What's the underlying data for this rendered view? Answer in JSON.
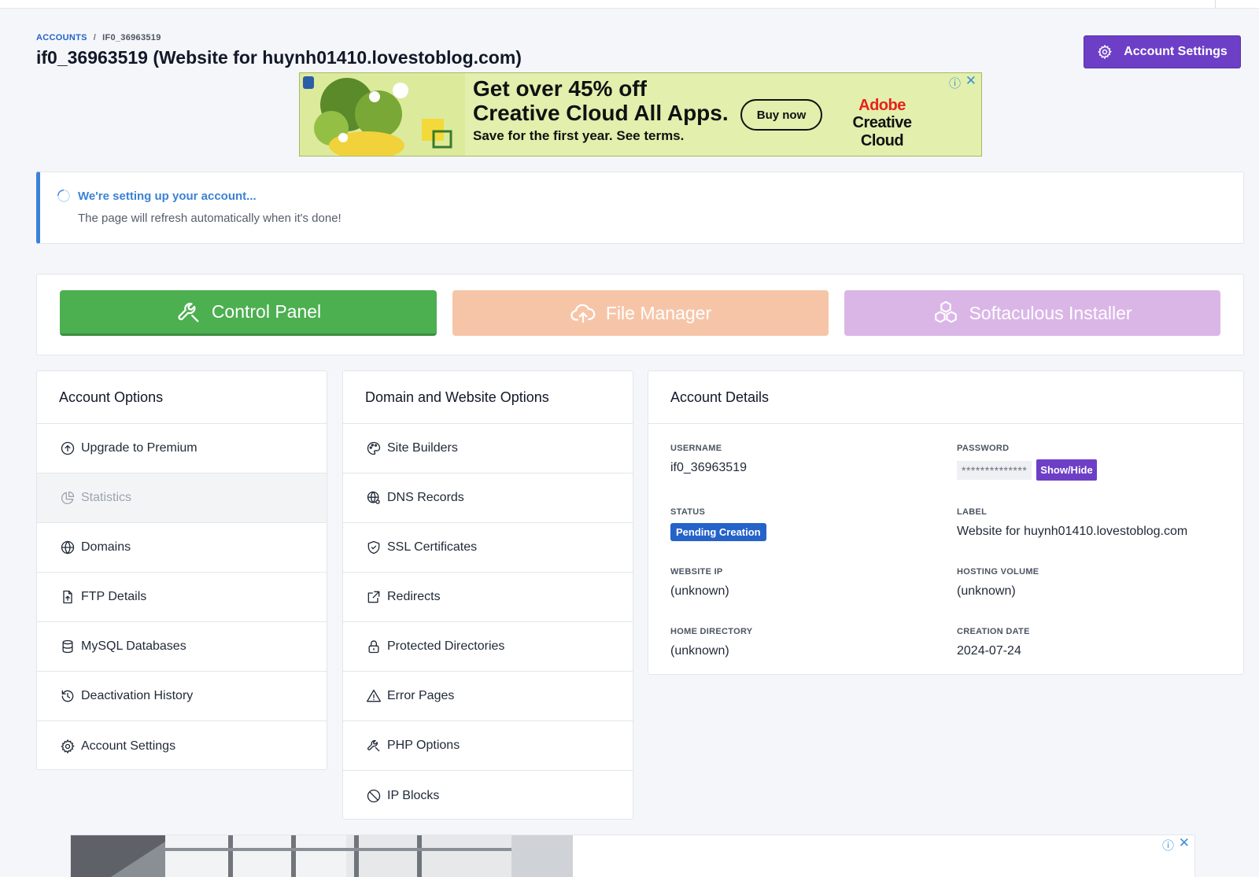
{
  "breadcrumb": {
    "root": "ACCOUNTS",
    "separator": "/",
    "current": "IF0_36963519"
  },
  "page": {
    "title": "if0_36963519 (Website for huynh01410.lovestoblog.com)"
  },
  "header_button": {
    "label": "Account Settings",
    "icon": "gear-icon"
  },
  "ad_top": {
    "headline_line1": "Get over 45% off",
    "headline_line2": "Creative Cloud All Apps.",
    "subtext": "Save for the first year. See terms.",
    "cta": "Buy now",
    "brand_line1": "Adobe",
    "brand_line2": "Creative Cloud",
    "info_icon": "ⓘ",
    "close_icon": "✕"
  },
  "notice": {
    "title": "We're setting up your account...",
    "text": "The page will refresh automatically when it's done!"
  },
  "big_buttons": [
    {
      "label": "Control Panel",
      "icon": "wrench-icon",
      "color": "#4caf50"
    },
    {
      "label": "File Manager",
      "icon": "cloud-upload-icon",
      "color": "#f6c5a8"
    },
    {
      "label": "Softaculous Installer",
      "icon": "boxes-icon",
      "color": "#dab6e7"
    }
  ],
  "account_options": {
    "title": "Account Options",
    "items": [
      {
        "label": "Upgrade to Premium",
        "icon": "arrow-up-circle-icon"
      },
      {
        "label": "Statistics",
        "icon": "pie-chart-icon",
        "disabled": true
      },
      {
        "label": "Domains",
        "icon": "globe-icon"
      },
      {
        "label": "FTP Details",
        "icon": "file-upload-icon"
      },
      {
        "label": "MySQL Databases",
        "icon": "database-icon"
      },
      {
        "label": "Deactivation History",
        "icon": "history-icon"
      },
      {
        "label": "Account Settings",
        "icon": "gear-icon"
      }
    ]
  },
  "domain_options": {
    "title": "Domain and Website Options",
    "items": [
      {
        "label": "Site Builders",
        "icon": "palette-icon"
      },
      {
        "label": "DNS Records",
        "icon": "globe-network-icon"
      },
      {
        "label": "SSL Certificates",
        "icon": "shield-check-icon"
      },
      {
        "label": "Redirects",
        "icon": "external-link-icon"
      },
      {
        "label": "Protected Directories",
        "icon": "lock-icon"
      },
      {
        "label": "Error Pages",
        "icon": "warning-icon"
      },
      {
        "label": "PHP Options",
        "icon": "wrench-icon"
      },
      {
        "label": "IP Blocks",
        "icon": "ban-icon"
      }
    ]
  },
  "account_details": {
    "title": "Account Details",
    "username_label": "USERNAME",
    "username": "if0_36963519",
    "password_label": "PASSWORD",
    "password_masked": "**************",
    "password_toggle": "Show/Hide",
    "status_label": "STATUS",
    "status": "Pending Creation",
    "label_label": "LABEL",
    "label": "Website for huynh01410.lovestoblog.com",
    "website_ip_label": "WEBSITE IP",
    "website_ip": "(unknown)",
    "hosting_volume_label": "HOSTING VOLUME",
    "hosting_volume": "(unknown)",
    "home_directory_label": "HOME DIRECTORY",
    "home_directory": "(unknown)",
    "creation_date_label": "CREATION DATE",
    "creation_date": "2024-07-24"
  },
  "ad_bottom": {
    "info_icon": "ⓘ",
    "close_icon": "✕"
  }
}
